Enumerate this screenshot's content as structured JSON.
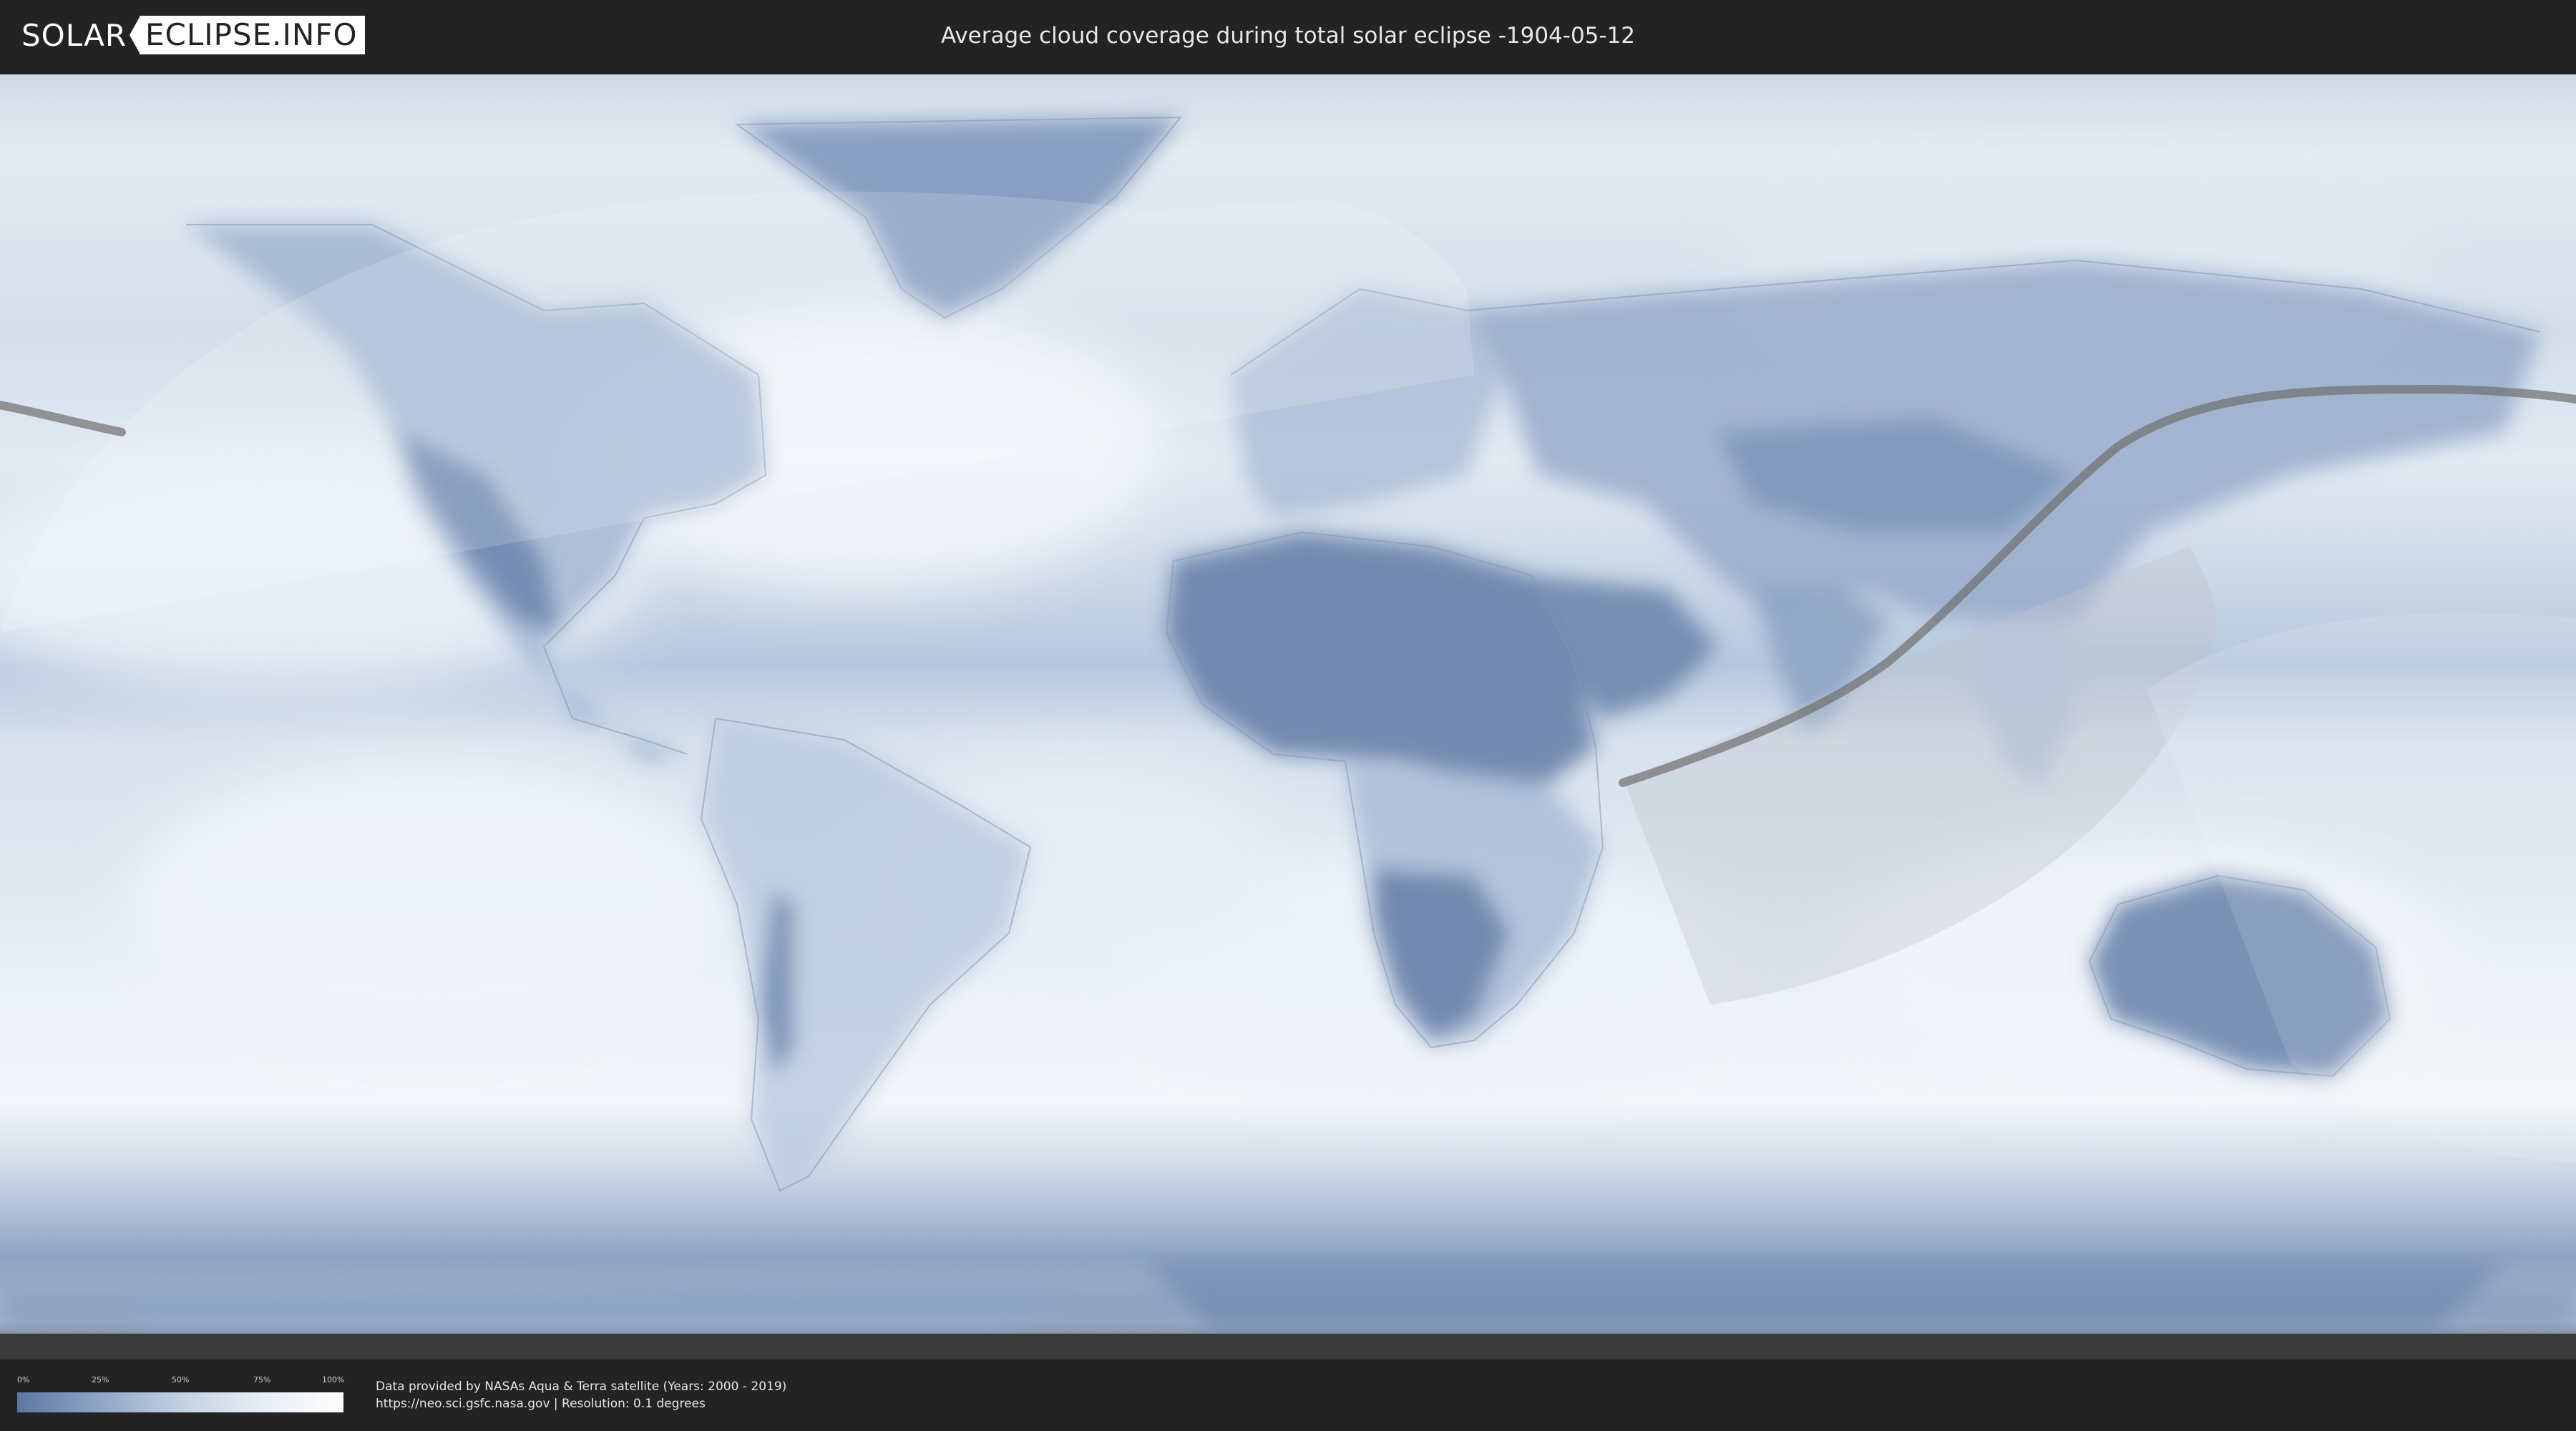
{
  "header": {
    "logo_left": "SOLAR",
    "logo_right": "ECLIPSE.INFO",
    "title": "Average cloud coverage during total solar eclipse -1904-05-12"
  },
  "legend": {
    "ticks": [
      "0%",
      "25%",
      "50%",
      "75%",
      "100%"
    ],
    "colors": [
      "#5b77a3",
      "#8fa5c6",
      "#c2d0e2",
      "#e6edf5",
      "#ffffff"
    ]
  },
  "credits": {
    "line1": "Data provided by NASAs Aqua & Terra satellite (Years: 2000 - 2019)",
    "line2": "https://neo.sci.gsfc.nasa.gov | Resolution: 0.1 degrees"
  },
  "colors": {
    "background": "#232323",
    "ocean_base": "#dde6f1",
    "land_clear": "#6a83ab",
    "eclipse_path": "#6f6f6f"
  }
}
